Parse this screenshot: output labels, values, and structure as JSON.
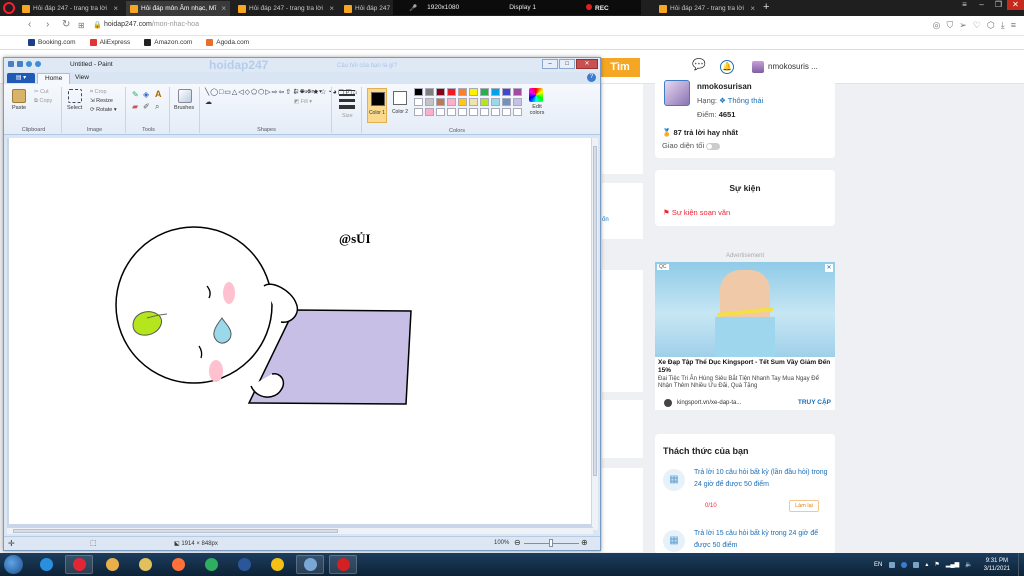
{
  "browser": {
    "tabs": [
      {
        "label": "Hỏi đáp 247 - trang tra lời",
        "active": false
      },
      {
        "label": "Hỏi đáp môn Âm nhạc, Mĩ",
        "active": true
      },
      {
        "label": "Hỏi đáp 247 - trang tra lời",
        "active": false
      },
      {
        "label": "Hỏi đáp 247",
        "active": false
      },
      {
        "label": "Hỏi đáp 247 - trang tra lời",
        "active": false
      }
    ],
    "recorder": {
      "resolution": "1920x1080",
      "display": "Display 1",
      "rec": "REC"
    },
    "url_host": "hoidap247.com",
    "url_path": "/mon-nhac-hoa",
    "bookmarks": [
      {
        "label": "Booking.com",
        "color": "#1a3f87"
      },
      {
        "label": "AliExpress",
        "color": "#e3342f"
      },
      {
        "label": "Amazon.com",
        "color": "#222222"
      },
      {
        "label": "Agoda.com",
        "color": "#e86e2c"
      }
    ]
  },
  "site": {
    "search_button": "Tìm",
    "header_username": "nmokosuris ...",
    "profile": {
      "name": "nmokosurisan",
      "rank_label": "Hạng:",
      "rank_value": "Thông thái",
      "points_label": "Điểm:",
      "points_value": "4651",
      "answers": "87 trả lời hay nhất",
      "dark_mode": "Giao diện tối"
    },
    "events": {
      "title": "Sự kiện",
      "item": "Sự kiện soạn văn"
    },
    "ad": {
      "label": "Advertisement",
      "qc": "QC",
      "title": "Xe Đạp Tập Thể Dục Kingsport - Tết Sum Vầy Giảm Đến 15%",
      "desc": "Đại Tiệc Tri Ân Hùng Siêu Bắt Tiện Nhanh Tay Mua Ngay Để Nhận Thêm Nhiều Ưu Đãi, Quà Tặng",
      "link": "kingsport.vn/xe-dap-ta...",
      "cta": "TRUY CẬP"
    },
    "challenges": {
      "title": "Thách thức của bạn",
      "items": [
        {
          "text": "Trả lời 10 câu hỏi bất kỳ (lần đầu hỏi) trong 24 giờ để được 50 điểm",
          "progress": "0/10",
          "button": "Làm lại"
        },
        {
          "text": "Trả lời 15 câu hỏi bất kỳ trong 24 giờ để được 50 điểm"
        }
      ]
    },
    "gutter_text": "ốn"
  },
  "paint": {
    "title": "Untitled - Paint",
    "ghost_logo": "hoidap247",
    "ghost_search": "Câu hỏi của bạn là gì?",
    "tabs": {
      "home": "Home",
      "view": "View"
    },
    "groups": {
      "clipboard": "Clipboard",
      "image": "Image",
      "tools": "Tools",
      "shapes": "Shapes",
      "colors": "Colors"
    },
    "buttons": {
      "paste": "Paste",
      "cut": "Cut",
      "copy": "Copy",
      "select": "Select",
      "crop": "Crop",
      "resize": "Resize",
      "rotate": "Rotate",
      "brushes": "Brushes",
      "outline": "Outline",
      "fill": "Fill",
      "size": "Size",
      "color1": "Color 1",
      "color2": "Color 2",
      "edit_colors": "Edit colors"
    },
    "palette": [
      "#000000",
      "#7f7f7f",
      "#880015",
      "#ed1c24",
      "#ff7f27",
      "#fff200",
      "#22b14c",
      "#00a2e8",
      "#3f48cc",
      "#a349a4",
      "#ffffff",
      "#c3c3c3",
      "#b97a57",
      "#ffaec9",
      "#ffc90e",
      "#efe4b0",
      "#b5e61d",
      "#99d9ea",
      "#7092be",
      "#c8bfe7",
      "#ffffff",
      "#ffaec9",
      "#ffffff",
      "#ffffff",
      "#ffffff",
      "#ffffff",
      "#ffffff",
      "#ffffff",
      "#ffffff",
      "#ffffff"
    ],
    "color1": "#000000",
    "color2": "#ffffff",
    "drawing": {
      "text": "@sỦI",
      "pillow_color": "#c8bfe7",
      "leaf_color": "#b5e61d",
      "tear_color": "#99d9ea",
      "blush_color": "#ffc0d0"
    },
    "status": {
      "size": "1914 × 848px",
      "zoom": "100%"
    }
  },
  "taskbar": {
    "apps": [
      {
        "name": "ie",
        "color": "#2b8fe0",
        "open": false
      },
      {
        "name": "opera",
        "color": "#e32636",
        "open": true
      },
      {
        "name": "media",
        "color": "#e8b04a",
        "open": false
      },
      {
        "name": "explorer",
        "color": "#e2c15c",
        "open": false
      },
      {
        "name": "firefox",
        "color": "#ff7139",
        "open": false
      },
      {
        "name": "app-green",
        "color": "#2fae60",
        "open": false
      },
      {
        "name": "word",
        "color": "#2b579a",
        "open": false
      },
      {
        "name": "chrome",
        "color": "#f3c013",
        "open": false
      },
      {
        "name": "paint",
        "color": "#7aa7d6",
        "open": true
      },
      {
        "name": "recorder",
        "color": "#d42020",
        "open": true
      }
    ],
    "lang": "EN",
    "time": "9:31 PM",
    "date": "3/11/2021"
  }
}
